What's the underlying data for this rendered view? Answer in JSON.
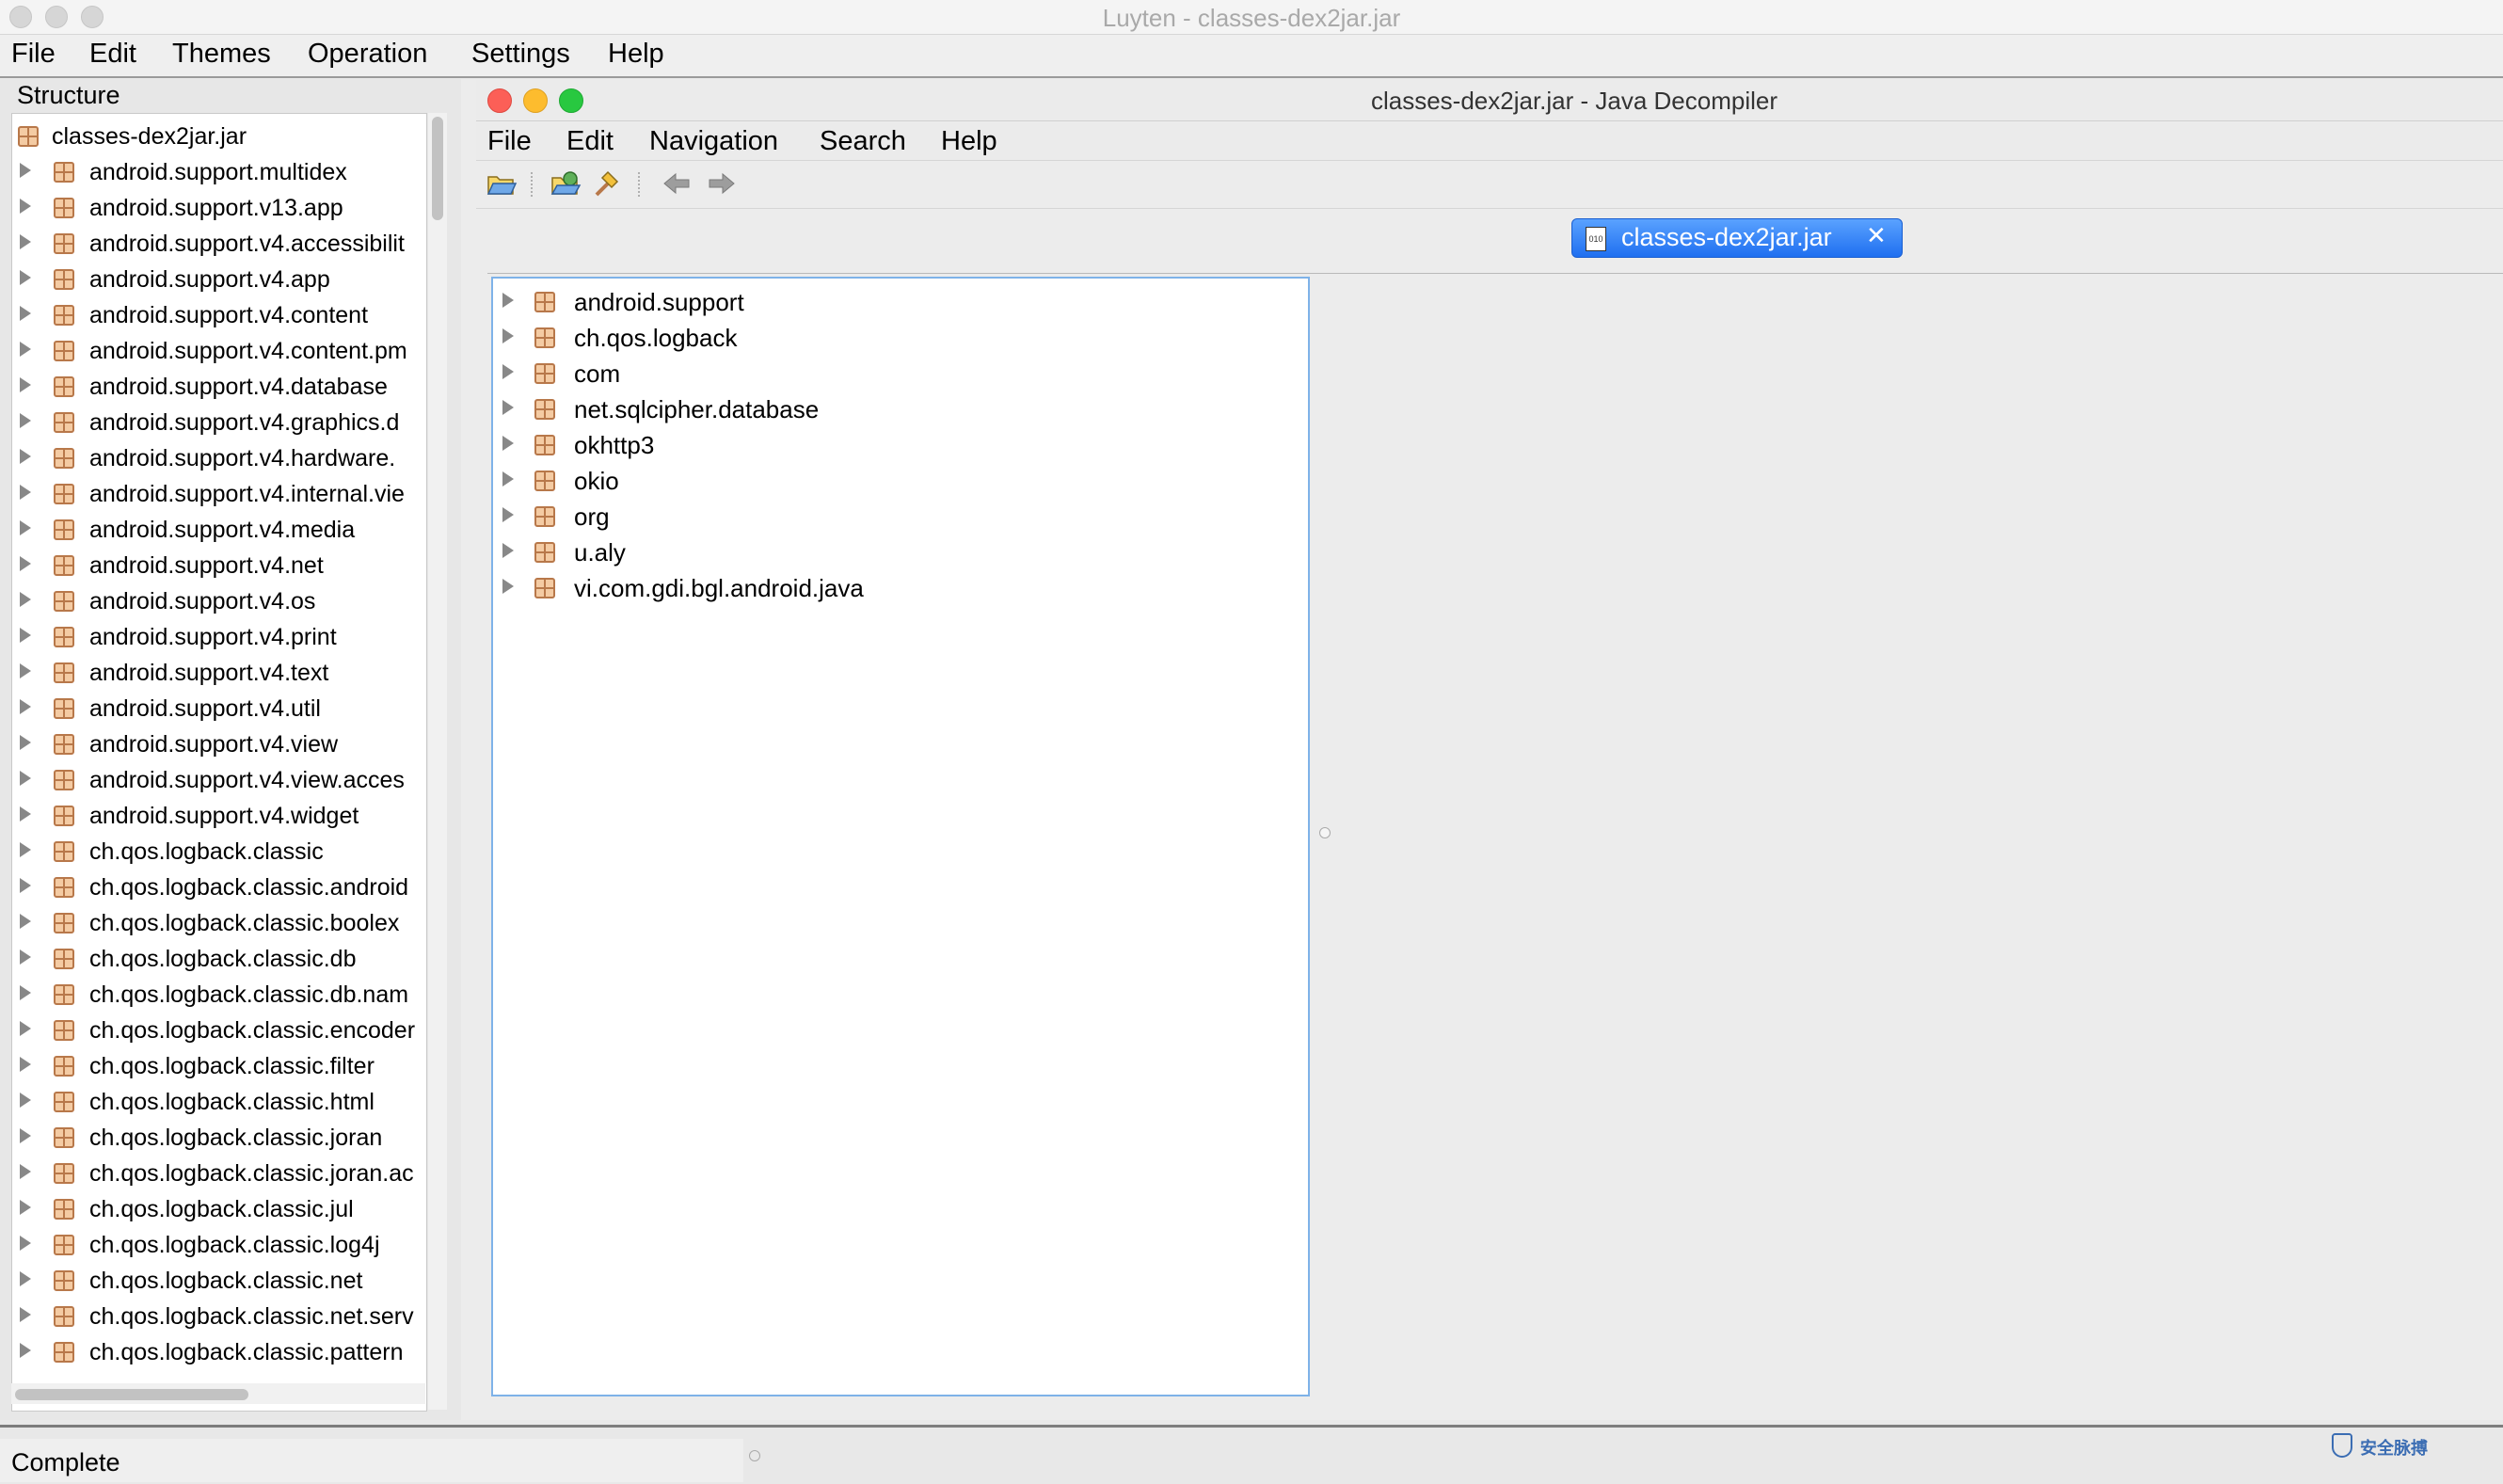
{
  "outer_window": {
    "title": "Luyten - classes-dex2jar.jar",
    "menu": [
      "File",
      "Edit",
      "Themes",
      "Operation",
      "Settings",
      "Help"
    ]
  },
  "structure": {
    "label": "Structure",
    "root": "classes-dex2jar.jar",
    "items": [
      "android.support.multidex",
      "android.support.v13.app",
      "android.support.v4.accessibilit",
      "android.support.v4.app",
      "android.support.v4.content",
      "android.support.v4.content.pm",
      "android.support.v4.database",
      "android.support.v4.graphics.d",
      "android.support.v4.hardware.",
      "android.support.v4.internal.vie",
      "android.support.v4.media",
      "android.support.v4.net",
      "android.support.v4.os",
      "android.support.v4.print",
      "android.support.v4.text",
      "android.support.v4.util",
      "android.support.v4.view",
      "android.support.v4.view.acces",
      "android.support.v4.widget",
      "ch.qos.logback.classic",
      "ch.qos.logback.classic.android",
      "ch.qos.logback.classic.boolex",
      "ch.qos.logback.classic.db",
      "ch.qos.logback.classic.db.nam",
      "ch.qos.logback.classic.encoder",
      "ch.qos.logback.classic.filter",
      "ch.qos.logback.classic.html",
      "ch.qos.logback.classic.joran",
      "ch.qos.logback.classic.joran.ac",
      "ch.qos.logback.classic.jul",
      "ch.qos.logback.classic.log4j",
      "ch.qos.logback.classic.net",
      "ch.qos.logback.classic.net.serv",
      "ch.qos.logback.classic.pattern"
    ]
  },
  "inner_window": {
    "title": "classes-dex2jar.jar - Java Decompiler",
    "menu": [
      "File",
      "Edit",
      "Navigation",
      "Search",
      "Help"
    ],
    "tab": {
      "label": "classes-dex2jar.jar",
      "icon_text": "010"
    },
    "tree": [
      "android.support",
      "ch.qos.logback",
      "com",
      "net.sqlcipher.database",
      "okhttp3",
      "okio",
      "org",
      "u.aly",
      "vi.com.gdi.bgl.android.java"
    ]
  },
  "status": {
    "text": "Complete"
  },
  "watermark": {
    "text": "安全脉搏"
  },
  "colors": {
    "tab_blue": "#1f6ff0",
    "package_icon": "#b8784a",
    "tree_border": "#7eb2e8"
  }
}
